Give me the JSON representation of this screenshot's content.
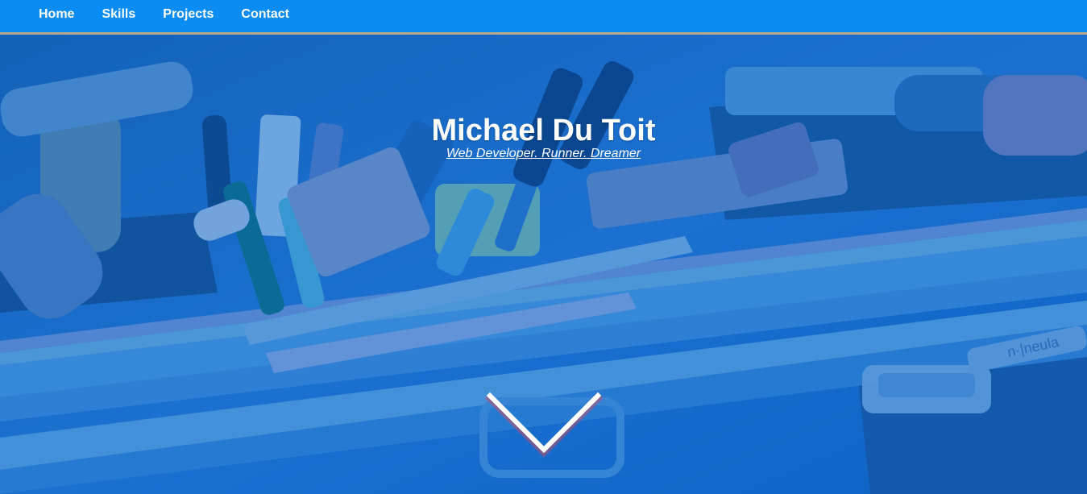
{
  "nav": {
    "items": [
      {
        "label": "Home"
      },
      {
        "label": "Skills"
      },
      {
        "label": "Projects"
      },
      {
        "label": "Contact"
      }
    ]
  },
  "hero": {
    "title": "Michael Du Toit",
    "subtitle": "Web Developer. Runner. Dreamer",
    "background_logo_text": "n·|neula",
    "overlay_color": "#0b66c8",
    "scroll_icon": "chevron-down-icon"
  },
  "colors": {
    "nav_bg": "#0a8cf5",
    "nav_border": "#b9a98c",
    "text": "#ffffff"
  }
}
